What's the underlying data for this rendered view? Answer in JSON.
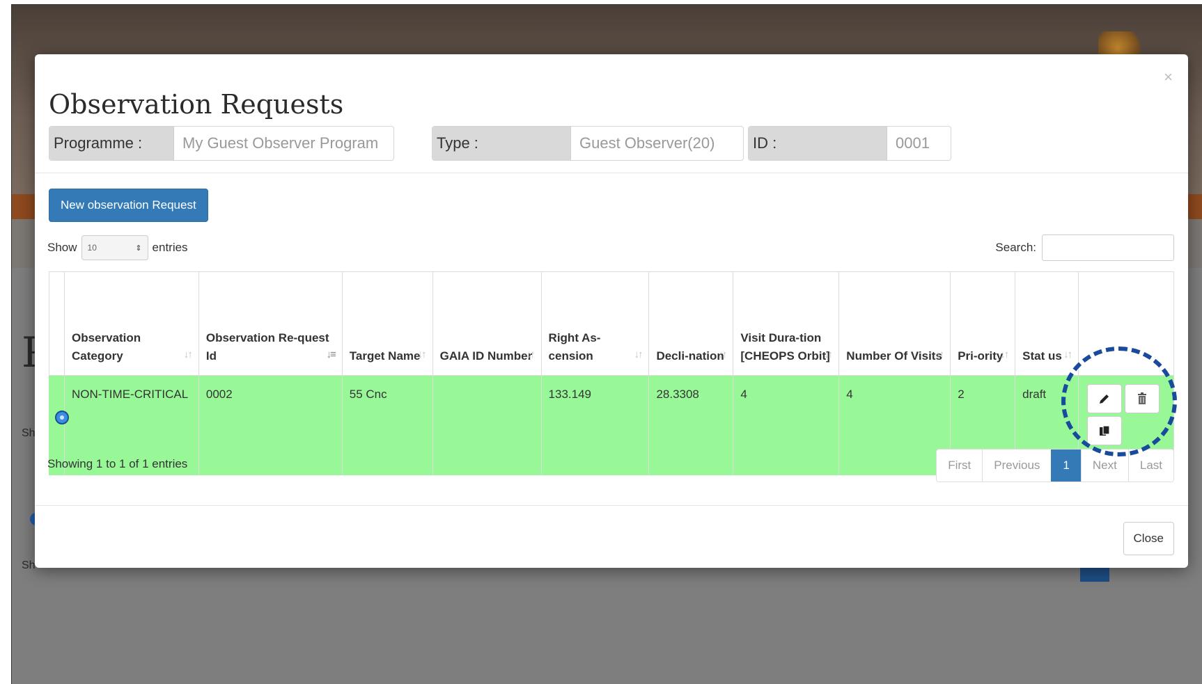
{
  "background": {
    "heading_letter": "P",
    "side_text_1": "Sh",
    "side_text_2": "Sh"
  },
  "modal": {
    "close_symbol": "×",
    "title": "Observation Requests",
    "info": {
      "programme_label": "Programme :",
      "programme_value": "My Guest Observer Program",
      "type_label": "Type :",
      "type_value": "Guest Observer(20)",
      "id_label": "ID :",
      "id_value": "0001"
    },
    "new_button_label": "New observation Request",
    "length": {
      "show_label": "Show",
      "selected": "10",
      "entries_label": "entries"
    },
    "search_label": "Search:",
    "table": {
      "headers": [
        "Observation Category",
        "Observation Re-quest Id",
        "Target Name",
        "GAIA ID Number",
        "Right As-cension",
        "Decli-nation",
        "Visit Dura-tion [CHEOPS Orbit]",
        "Number Of Visits",
        "Pri-ority",
        "Stat us"
      ],
      "rows": [
        {
          "category": "NON-TIME-CRITICAL",
          "request_id": "0002",
          "target_name": "55 Cnc",
          "gaia_id": "",
          "right_ascension": "133.149",
          "declination": "28.3308",
          "visit_duration": "4",
          "number_of_visits": "4",
          "priority": "2",
          "status": "draft"
        }
      ]
    },
    "showing_text": "Showing 1 to 1 of 1 entries",
    "pagination": {
      "first": "First",
      "previous": "Previous",
      "current": "1",
      "next": "Next",
      "last": "Last"
    },
    "close_button_label": "Close"
  },
  "colors": {
    "primary": "#337ab7",
    "row_highlight": "#98f898",
    "annotation_circle": "#1a4a9c"
  },
  "icons": {
    "edit": "pencil-icon",
    "delete": "trash-icon",
    "copy": "copy-icon"
  }
}
